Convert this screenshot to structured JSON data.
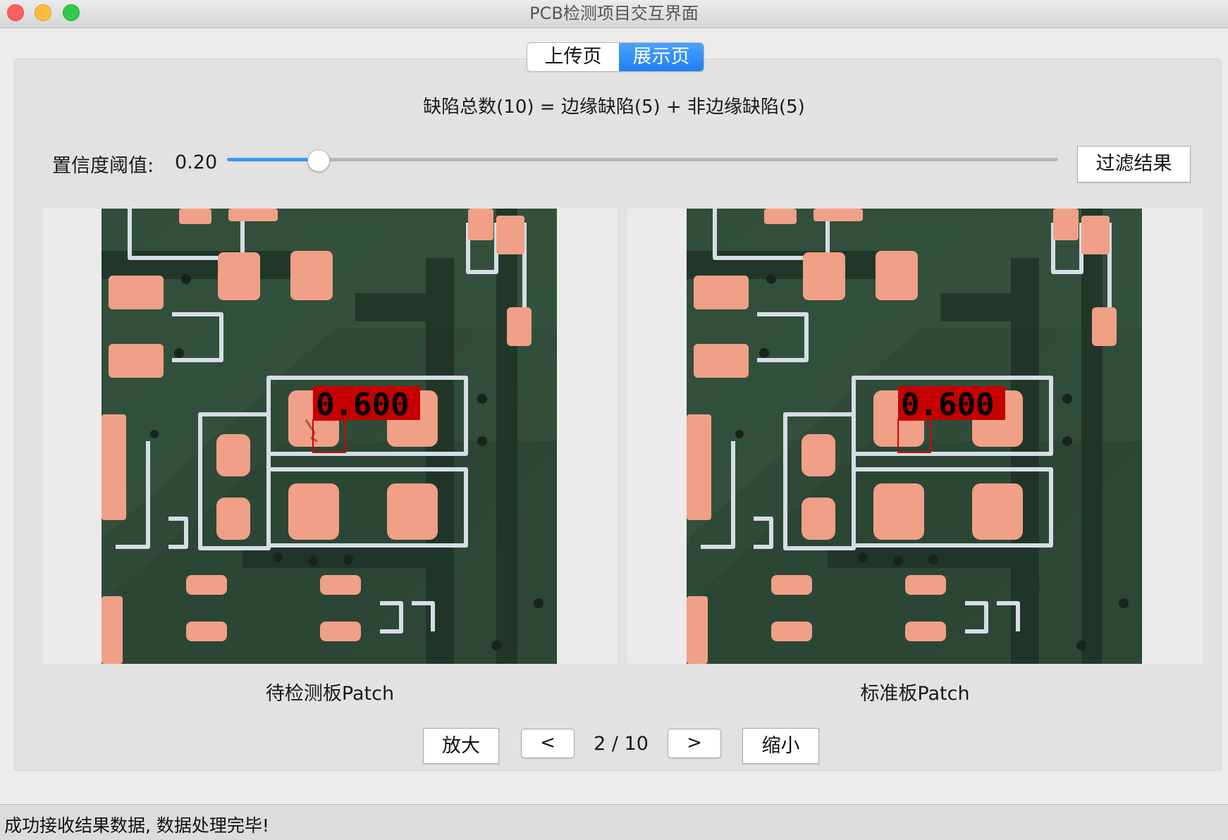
{
  "window": {
    "title": "PCB检测项目交互界面"
  },
  "tabs": [
    {
      "label": "上传页",
      "active": false
    },
    {
      "label": "展示页",
      "active": true
    }
  ],
  "summary": "缺陷总数(10) = 边缘缺陷(5) + 非边缘缺陷(5)",
  "threshold": {
    "label": "置信度阈值:",
    "value_text": "0.20",
    "value": 0.2,
    "slider_fraction": 0.11
  },
  "filter_button": "过滤结果",
  "images": {
    "test": {
      "caption": "待检测板Patch",
      "score_label": "0.600"
    },
    "reference": {
      "caption": "标准板Patch",
      "score_label": "0.600"
    }
  },
  "navigation": {
    "zoom_in": "放大",
    "prev": "<",
    "page": "2 / 10",
    "next": ">",
    "zoom_out": "缩小"
  },
  "status": "成功接收结果数据, 数据处理完毕!",
  "colors": {
    "accent": "#2585f5",
    "pcb_green": "#2f4a38",
    "pad_copper": "#f0a086",
    "silkscreen": "#d6dde6",
    "detection_box": "#d40000"
  }
}
